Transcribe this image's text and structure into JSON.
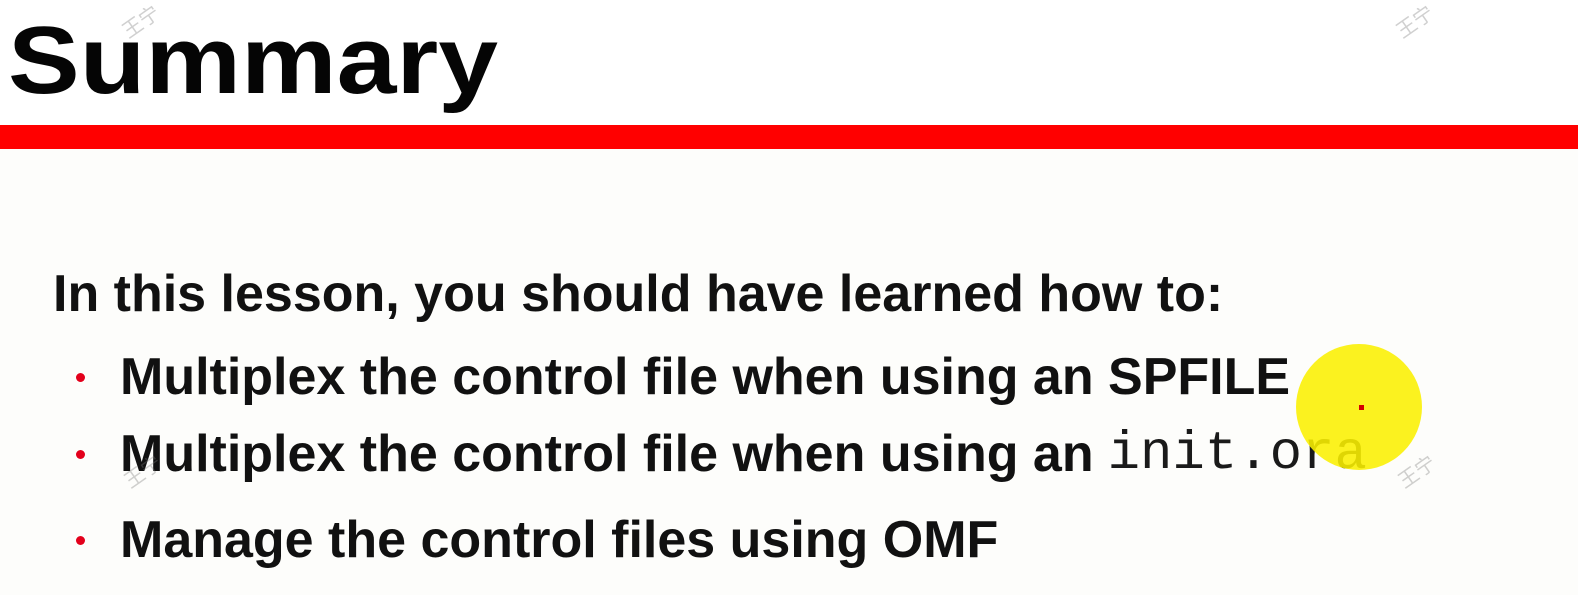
{
  "slide": {
    "title": "Summary",
    "intro": "In this lesson, you should have learned how to:",
    "bullets": [
      {
        "text": "Multiplex the control file when using an SPFILE",
        "code": ""
      },
      {
        "text": "Multiplex the control file when using an",
        "code": "init.ora"
      },
      {
        "text": "Manage the control files using OMF",
        "code": ""
      }
    ]
  },
  "watermark": "王宁",
  "colors": {
    "rule": "#ff0000",
    "bullet": "#e3001b",
    "pointer": "#faf000",
    "background": "#fdfdfb"
  }
}
